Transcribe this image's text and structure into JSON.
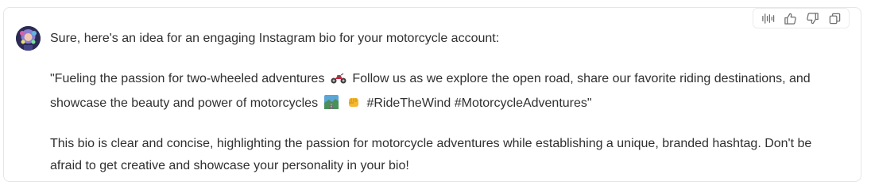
{
  "toolbar": {
    "icons": [
      "voice-icon",
      "thumbs-up-icon",
      "thumbs-down-icon",
      "copy-icon"
    ]
  },
  "message": {
    "intro": "Sure, here's an idea for an engaging Instagram bio for your motorcycle account:",
    "bio_part1": "\"Fueling the passion for two-wheeled adventures",
    "bio_part2": "Follow us as we explore the open road, share our favorite riding destinations, and showcase the beauty and power of motorcycles",
    "bio_part3": "#RideTheWind #MotorcycleAdventures\"",
    "closing": "This bio is clear and concise, highlighting the passion for motorcycle adventures while establishing a unique, branded hashtag. Don't be afraid to get creative and showcase your personality in your bio!"
  },
  "colors": {
    "text": "#303030",
    "border": "#e6e6e6",
    "icon": "#6b6b6b"
  }
}
